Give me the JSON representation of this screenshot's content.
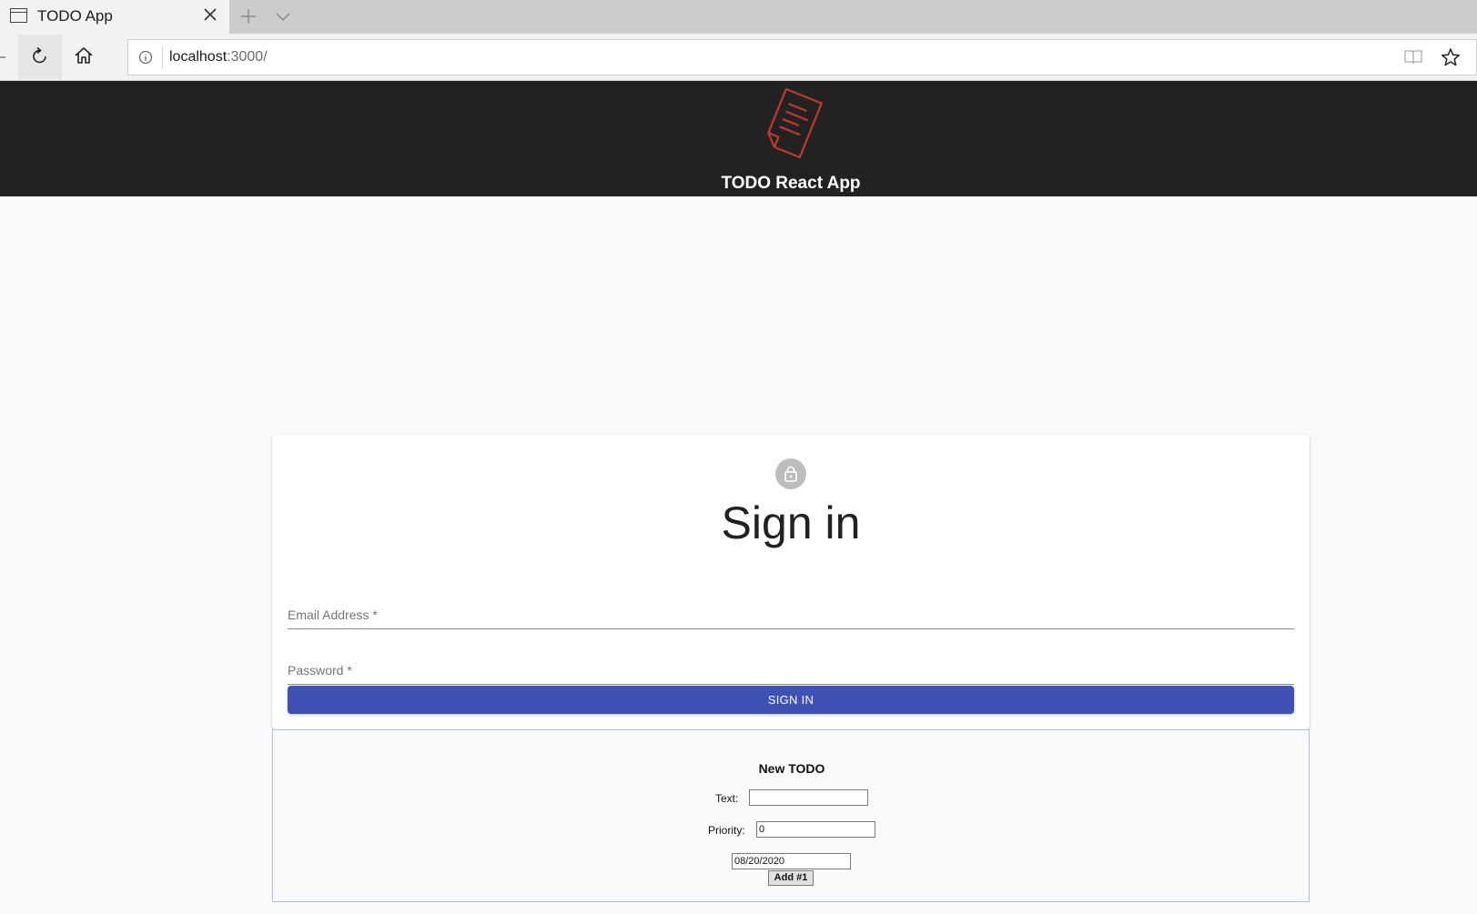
{
  "browser": {
    "tab": {
      "title": "TODO App"
    },
    "address": {
      "host": "localhost",
      "rest": ":3000/"
    }
  },
  "app": {
    "title": "TODO React App",
    "logo_icon": "document-todo-icon",
    "accent_color": "#c0392b"
  },
  "signin": {
    "title": "Sign in",
    "email_label": "Email Address *",
    "password_label": "Password *",
    "button_label": "SIGN IN",
    "button_color": "#3f51b5",
    "avatar_icon": "lock-icon"
  },
  "todo_form": {
    "title": "New TODO",
    "text_label": "Text:",
    "text_value": "",
    "priority_label": "Priority:",
    "priority_value": "0",
    "date_value": "08/20/2020",
    "add_button_label": "Add #1"
  }
}
